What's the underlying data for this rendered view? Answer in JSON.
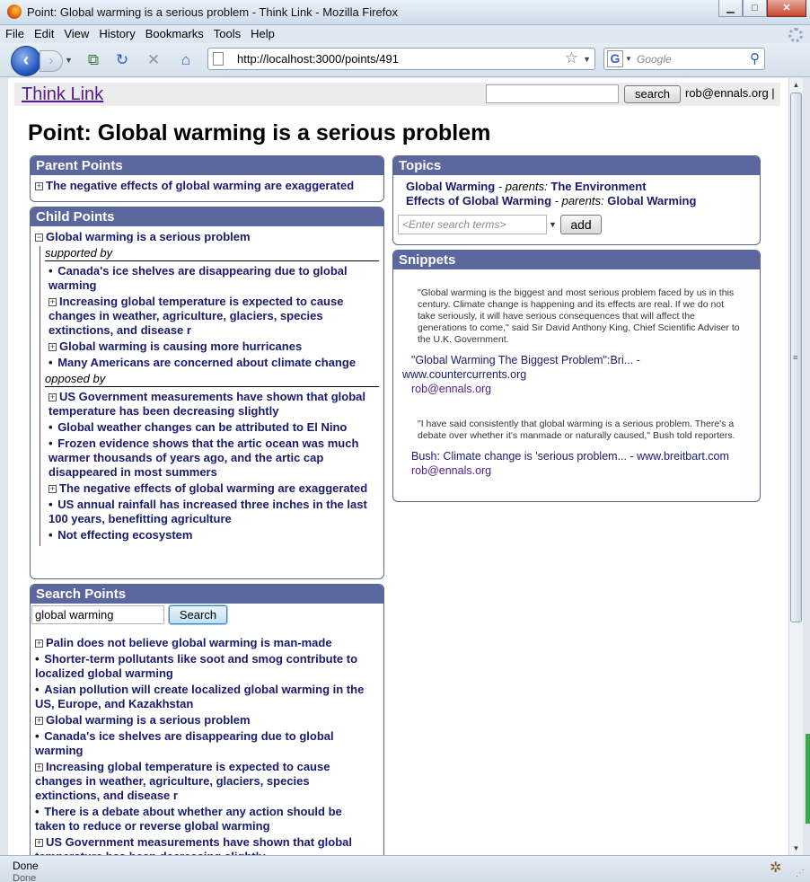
{
  "browser": {
    "window_title": "Point: Global warming is a serious problem - Think Link - Mozilla Firefox",
    "menu": [
      "File",
      "Edit",
      "View",
      "History",
      "Bookmarks",
      "Tools",
      "Help"
    ],
    "url": "http://localhost:3000/points/491",
    "search_placeholder": "Google",
    "status": "Done",
    "status_ghost": "Done"
  },
  "header": {
    "logo": "Think Link",
    "search_button": "search",
    "user": "rob@ennals.org |"
  },
  "page": {
    "title": "Point: Global warming is a serious problem"
  },
  "parent_points": {
    "heading": "Parent Points",
    "items": [
      {
        "text": "The negative effects of global warming are exaggerated",
        "expand": "+"
      }
    ]
  },
  "child_points": {
    "heading": "Child Points",
    "root": {
      "text": "Global warming is a serious problem",
      "expand": "−"
    },
    "supported_label": "supported by",
    "supported": [
      {
        "text": "Canada's ice shelves are disappearing due to global warming",
        "marker": "•"
      },
      {
        "text": "Increasing global temperature is expected to cause changes in weather, agriculture, glaciers, species extinctions, and disease r",
        "marker": "+"
      },
      {
        "text": "Global warming is causing more hurricanes",
        "marker": "+"
      },
      {
        "text": "Many Americans are concerned about climate change",
        "marker": "•"
      }
    ],
    "opposed_label": "opposed by",
    "opposed": [
      {
        "text": "US Government measurements have shown that global temperature has been decreasing slightly",
        "marker": "+"
      },
      {
        "text": "Global weather changes can be attributed to El Nino",
        "marker": "•"
      },
      {
        "text": "Frozen evidence shows that the artic ocean was much warmer thousands of years ago, and the artic cap disappeared in most summers",
        "marker": "•"
      },
      {
        "text": "The negative effects of global warming are exaggerated",
        "marker": "+"
      },
      {
        "text": "US annual rainfall has increased three inches in the last 100 years, benefitting agriculture",
        "marker": "•"
      },
      {
        "text": "Not effecting ecosystem",
        "marker": "•"
      }
    ]
  },
  "search_points": {
    "heading": "Search Points",
    "query": "global warming",
    "button": "Search",
    "results": [
      {
        "text": "Palin does not believe global warming is man-made",
        "marker": "+"
      },
      {
        "text": "Shorter-term pollutants like soot and smog contribute to localized global warming",
        "marker": "•"
      },
      {
        "text": "Asian pollution will create localized global warming in the US, Europe, and Kazakhstan",
        "marker": "•"
      },
      {
        "text": "Global warming is a serious problem",
        "marker": "+"
      },
      {
        "text": "Canada's ice shelves are disappearing due to global warming",
        "marker": "•"
      },
      {
        "text": "Increasing global temperature is expected to cause changes in weather, agriculture, glaciers, species extinctions, and disease r",
        "marker": "+"
      },
      {
        "text": "There is a debate about whether any action should be taken to reduce or reverse global warming",
        "marker": "•"
      },
      {
        "text": "US Government measurements have shown that global temperature has been decreasing slightly",
        "marker": "+"
      }
    ]
  },
  "topics": {
    "heading": "Topics",
    "items": [
      {
        "name": "Global Warming",
        "parents_label": "- parents:",
        "parent": "The Environment"
      },
      {
        "name": "Effects of Global Warming",
        "parents_label": "- parents:",
        "parent": "Global Warming"
      }
    ],
    "input_placeholder": "<Enter search terms>",
    "add_button": "add"
  },
  "snippets": {
    "heading": "Snippets",
    "items": [
      {
        "quote": "\"Global warming is the biggest and most serious problem faced by us in this century. Climate change is happening and its effects are real. If we do not take seriously, it will have serious consequences that will affect the generations to come,\" said Sir David Anthony King, Chief Scientific Adviser to the U.K. Government.",
        "source": "\"Global Warming The Biggest Problem\":Bri... - www.countercurrents.org",
        "user": "rob@ennals.org"
      },
      {
        "quote": "\"I have said consistently that global warming is a serious problem. There's a debate over whether it's manmade or naturally caused,\" Bush told reporters.",
        "source": "Bush: Climate change is 'serious problem... - www.breitbart.com",
        "user": "rob@ennals.org"
      }
    ]
  }
}
